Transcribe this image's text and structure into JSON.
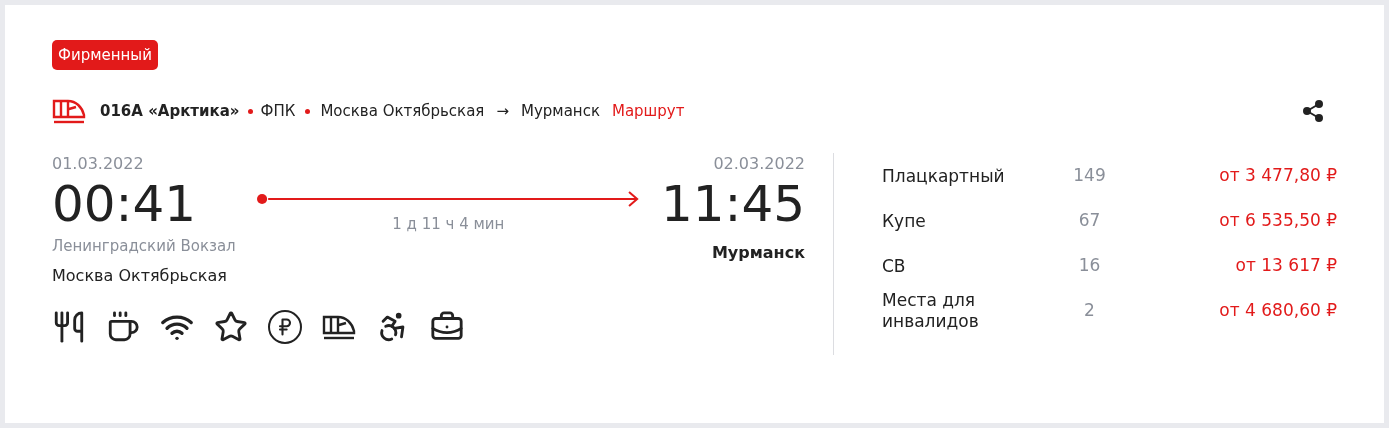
{
  "badge": "Фирменный",
  "train": {
    "number": "016A «Арктика»",
    "carrier": "ФПК",
    "from": "Москва Октябрьская",
    "arrow": "→",
    "to": "Мурманск",
    "route_link": "Маршрут"
  },
  "departure": {
    "date": "01.03.2022",
    "time": "00:41",
    "station": "Ленинградский Вокзал",
    "city": "Москва Октябрьская"
  },
  "duration": "1 д 11 ч 4 мин",
  "arrival": {
    "date": "02.03.2022",
    "time": "11:45",
    "city": "Мурманск"
  },
  "amenities": [
    {
      "kind": "restaurant"
    },
    {
      "kind": "coffee"
    },
    {
      "kind": "wifi"
    },
    {
      "kind": "star"
    },
    {
      "kind": "ruble"
    },
    {
      "kind": "train"
    },
    {
      "kind": "wheelchair"
    },
    {
      "kind": "luggage"
    }
  ],
  "classes": [
    {
      "name": "Плацкартный",
      "seats": "149",
      "price": "от 3 477,80 ₽"
    },
    {
      "name": "Купе",
      "seats": "67",
      "price": "от 6 535,50 ₽"
    },
    {
      "name": "СВ",
      "seats": "16",
      "price": "от 13 617 ₽"
    },
    {
      "name": "Места для инвалидов",
      "seats": "2",
      "price": "от 4 680,60 ₽"
    }
  ]
}
